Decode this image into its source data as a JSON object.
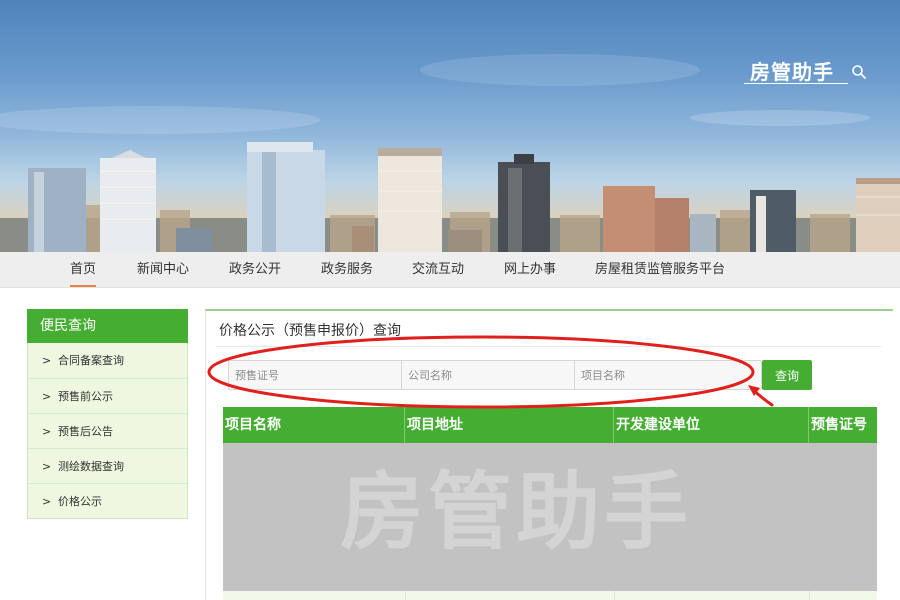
{
  "banner": {
    "brand": "房管助手",
    "search_icon": "search-icon",
    "colors": {
      "sky_top": "#4f83bb",
      "sky_mid": "#93b9dc",
      "haze": "#c9b79b"
    }
  },
  "nav": {
    "items": [
      {
        "label": "首页",
        "active": true
      },
      {
        "label": "新闻中心"
      },
      {
        "label": "政务公开"
      },
      {
        "label": "政务服务"
      },
      {
        "label": "交流互动"
      },
      {
        "label": "网上办事"
      },
      {
        "label": "房屋租赁监管服务平台"
      }
    ],
    "active_color": "#e8823c"
  },
  "sidebar": {
    "title": "便民查询",
    "chevron": ">",
    "items": [
      {
        "label": "合同备案查询"
      },
      {
        "label": "预售前公示"
      },
      {
        "label": "预售后公告"
      },
      {
        "label": "测绘数据查询"
      },
      {
        "label": "价格公示"
      }
    ]
  },
  "main": {
    "title": "价格公示（预售申报价）查询",
    "search": {
      "presale_placeholder": "预售证号",
      "company_placeholder": "公司名称",
      "project_placeholder": "项目名称",
      "presale_value": "",
      "company_value": "",
      "project_value": "",
      "button_label": "查询"
    },
    "table": {
      "headers": [
        "项目名称",
        "项目地址",
        "开发建设单位",
        "预售证号"
      ],
      "watermark": "房管助手"
    }
  },
  "theme": {
    "green": "#45ae32",
    "light_green": "#eef7df",
    "annotation_red": "#e0201c"
  }
}
